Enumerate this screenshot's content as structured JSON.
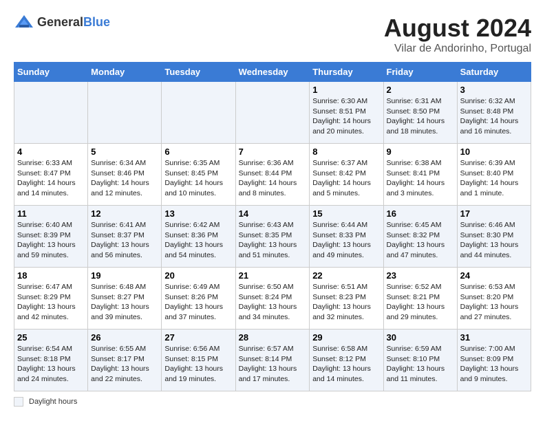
{
  "logo": {
    "text_general": "General",
    "text_blue": "Blue"
  },
  "title": {
    "month_year": "August 2024",
    "location": "Vilar de Andorinho, Portugal"
  },
  "days_of_week": [
    "Sunday",
    "Monday",
    "Tuesday",
    "Wednesday",
    "Thursday",
    "Friday",
    "Saturday"
  ],
  "legend": {
    "label": "Daylight hours"
  },
  "weeks": [
    [
      {
        "day": "",
        "sunrise": "",
        "sunset": "",
        "daylight": ""
      },
      {
        "day": "",
        "sunrise": "",
        "sunset": "",
        "daylight": ""
      },
      {
        "day": "",
        "sunrise": "",
        "sunset": "",
        "daylight": ""
      },
      {
        "day": "",
        "sunrise": "",
        "sunset": "",
        "daylight": ""
      },
      {
        "day": "1",
        "sunrise": "Sunrise: 6:30 AM",
        "sunset": "Sunset: 8:51 PM",
        "daylight": "Daylight: 14 hours and 20 minutes."
      },
      {
        "day": "2",
        "sunrise": "Sunrise: 6:31 AM",
        "sunset": "Sunset: 8:50 PM",
        "daylight": "Daylight: 14 hours and 18 minutes."
      },
      {
        "day": "3",
        "sunrise": "Sunrise: 6:32 AM",
        "sunset": "Sunset: 8:48 PM",
        "daylight": "Daylight: 14 hours and 16 minutes."
      }
    ],
    [
      {
        "day": "4",
        "sunrise": "Sunrise: 6:33 AM",
        "sunset": "Sunset: 8:47 PM",
        "daylight": "Daylight: 14 hours and 14 minutes."
      },
      {
        "day": "5",
        "sunrise": "Sunrise: 6:34 AM",
        "sunset": "Sunset: 8:46 PM",
        "daylight": "Daylight: 14 hours and 12 minutes."
      },
      {
        "day": "6",
        "sunrise": "Sunrise: 6:35 AM",
        "sunset": "Sunset: 8:45 PM",
        "daylight": "Daylight: 14 hours and 10 minutes."
      },
      {
        "day": "7",
        "sunrise": "Sunrise: 6:36 AM",
        "sunset": "Sunset: 8:44 PM",
        "daylight": "Daylight: 14 hours and 8 minutes."
      },
      {
        "day": "8",
        "sunrise": "Sunrise: 6:37 AM",
        "sunset": "Sunset: 8:42 PM",
        "daylight": "Daylight: 14 hours and 5 minutes."
      },
      {
        "day": "9",
        "sunrise": "Sunrise: 6:38 AM",
        "sunset": "Sunset: 8:41 PM",
        "daylight": "Daylight: 14 hours and 3 minutes."
      },
      {
        "day": "10",
        "sunrise": "Sunrise: 6:39 AM",
        "sunset": "Sunset: 8:40 PM",
        "daylight": "Daylight: 14 hours and 1 minute."
      }
    ],
    [
      {
        "day": "11",
        "sunrise": "Sunrise: 6:40 AM",
        "sunset": "Sunset: 8:39 PM",
        "daylight": "Daylight: 13 hours and 59 minutes."
      },
      {
        "day": "12",
        "sunrise": "Sunrise: 6:41 AM",
        "sunset": "Sunset: 8:37 PM",
        "daylight": "Daylight: 13 hours and 56 minutes."
      },
      {
        "day": "13",
        "sunrise": "Sunrise: 6:42 AM",
        "sunset": "Sunset: 8:36 PM",
        "daylight": "Daylight: 13 hours and 54 minutes."
      },
      {
        "day": "14",
        "sunrise": "Sunrise: 6:43 AM",
        "sunset": "Sunset: 8:35 PM",
        "daylight": "Daylight: 13 hours and 51 minutes."
      },
      {
        "day": "15",
        "sunrise": "Sunrise: 6:44 AM",
        "sunset": "Sunset: 8:33 PM",
        "daylight": "Daylight: 13 hours and 49 minutes."
      },
      {
        "day": "16",
        "sunrise": "Sunrise: 6:45 AM",
        "sunset": "Sunset: 8:32 PM",
        "daylight": "Daylight: 13 hours and 47 minutes."
      },
      {
        "day": "17",
        "sunrise": "Sunrise: 6:46 AM",
        "sunset": "Sunset: 8:30 PM",
        "daylight": "Daylight: 13 hours and 44 minutes."
      }
    ],
    [
      {
        "day": "18",
        "sunrise": "Sunrise: 6:47 AM",
        "sunset": "Sunset: 8:29 PM",
        "daylight": "Daylight: 13 hours and 42 minutes."
      },
      {
        "day": "19",
        "sunrise": "Sunrise: 6:48 AM",
        "sunset": "Sunset: 8:27 PM",
        "daylight": "Daylight: 13 hours and 39 minutes."
      },
      {
        "day": "20",
        "sunrise": "Sunrise: 6:49 AM",
        "sunset": "Sunset: 8:26 PM",
        "daylight": "Daylight: 13 hours and 37 minutes."
      },
      {
        "day": "21",
        "sunrise": "Sunrise: 6:50 AM",
        "sunset": "Sunset: 8:24 PM",
        "daylight": "Daylight: 13 hours and 34 minutes."
      },
      {
        "day": "22",
        "sunrise": "Sunrise: 6:51 AM",
        "sunset": "Sunset: 8:23 PM",
        "daylight": "Daylight: 13 hours and 32 minutes."
      },
      {
        "day": "23",
        "sunrise": "Sunrise: 6:52 AM",
        "sunset": "Sunset: 8:21 PM",
        "daylight": "Daylight: 13 hours and 29 minutes."
      },
      {
        "day": "24",
        "sunrise": "Sunrise: 6:53 AM",
        "sunset": "Sunset: 8:20 PM",
        "daylight": "Daylight: 13 hours and 27 minutes."
      }
    ],
    [
      {
        "day": "25",
        "sunrise": "Sunrise: 6:54 AM",
        "sunset": "Sunset: 8:18 PM",
        "daylight": "Daylight: 13 hours and 24 minutes."
      },
      {
        "day": "26",
        "sunrise": "Sunrise: 6:55 AM",
        "sunset": "Sunset: 8:17 PM",
        "daylight": "Daylight: 13 hours and 22 minutes."
      },
      {
        "day": "27",
        "sunrise": "Sunrise: 6:56 AM",
        "sunset": "Sunset: 8:15 PM",
        "daylight": "Daylight: 13 hours and 19 minutes."
      },
      {
        "day": "28",
        "sunrise": "Sunrise: 6:57 AM",
        "sunset": "Sunset: 8:14 PM",
        "daylight": "Daylight: 13 hours and 17 minutes."
      },
      {
        "day": "29",
        "sunrise": "Sunrise: 6:58 AM",
        "sunset": "Sunset: 8:12 PM",
        "daylight": "Daylight: 13 hours and 14 minutes."
      },
      {
        "day": "30",
        "sunrise": "Sunrise: 6:59 AM",
        "sunset": "Sunset: 8:10 PM",
        "daylight": "Daylight: 13 hours and 11 minutes."
      },
      {
        "day": "31",
        "sunrise": "Sunrise: 7:00 AM",
        "sunset": "Sunset: 8:09 PM",
        "daylight": "Daylight: 13 hours and 9 minutes."
      }
    ]
  ]
}
